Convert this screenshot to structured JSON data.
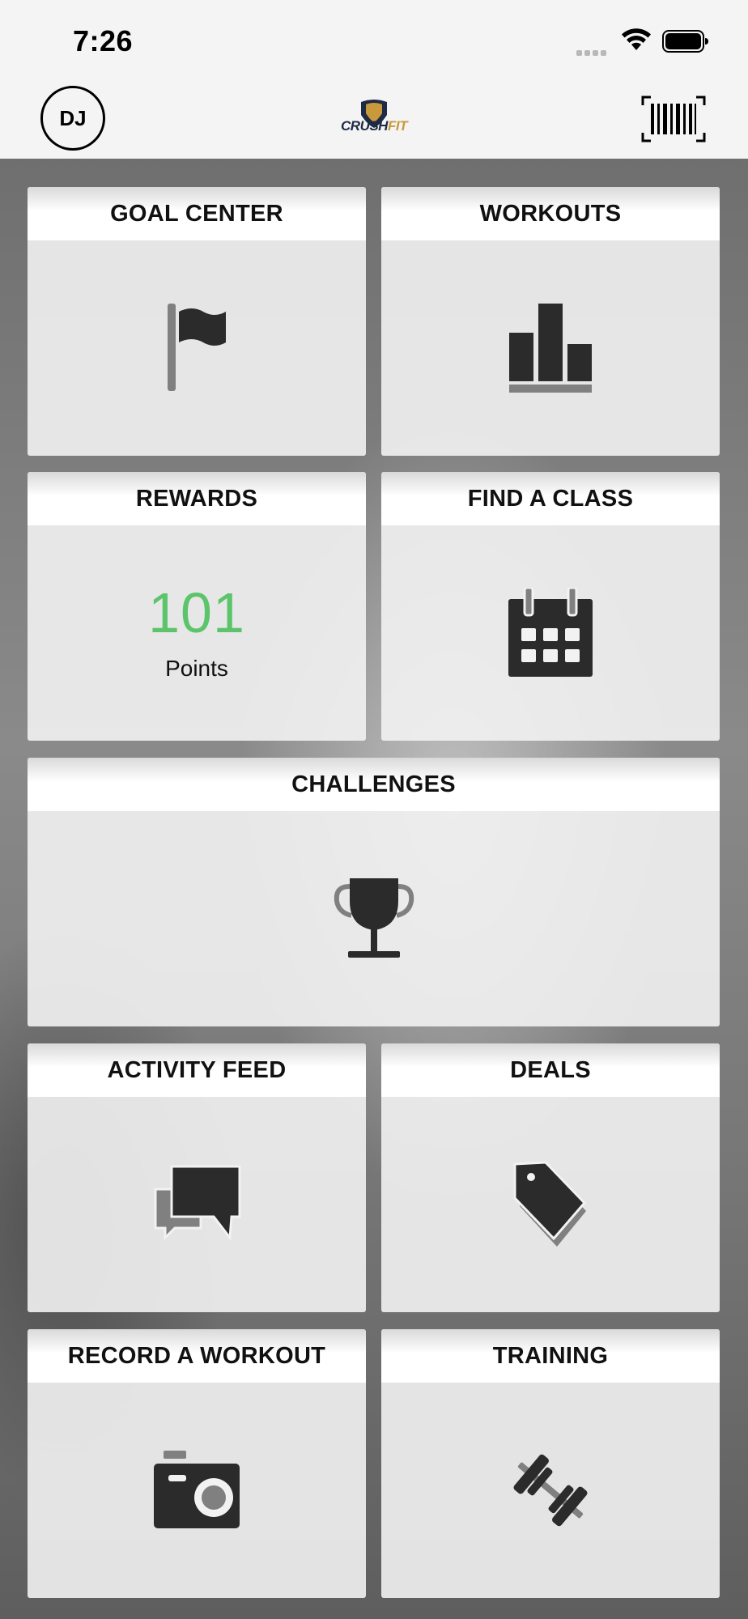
{
  "status_bar": {
    "time": "7:26"
  },
  "header": {
    "avatar_initials": "DJ",
    "logo_part1": "CRUSH",
    "logo_part2": "FIT",
    "icons": {
      "barcode": "barcode-scan-icon"
    }
  },
  "tiles": {
    "goal_center": {
      "title": "GOAL CENTER",
      "icon": "flag-icon"
    },
    "workouts": {
      "title": "WORKOUTS",
      "icon": "bar-chart-icon"
    },
    "rewards": {
      "title": "REWARDS",
      "points_value": "101",
      "points_label": "Points"
    },
    "find_a_class": {
      "title": "FIND A CLASS",
      "icon": "calendar-icon"
    },
    "challenges": {
      "title": "CHALLENGES",
      "icon": "trophy-icon"
    },
    "activity_feed": {
      "title": "ACTIVITY FEED",
      "icon": "chat-bubbles-icon"
    },
    "deals": {
      "title": "DEALS",
      "icon": "tag-icon"
    },
    "record_a_workout": {
      "title": "RECORD A WORKOUT",
      "icon": "camera-icon"
    },
    "training": {
      "title": "TRAINING",
      "icon": "dumbbell-icon"
    }
  },
  "colors": {
    "points_green": "#5cc46a",
    "icon_dark": "#2b2b2b",
    "icon_gray": "#808080"
  }
}
